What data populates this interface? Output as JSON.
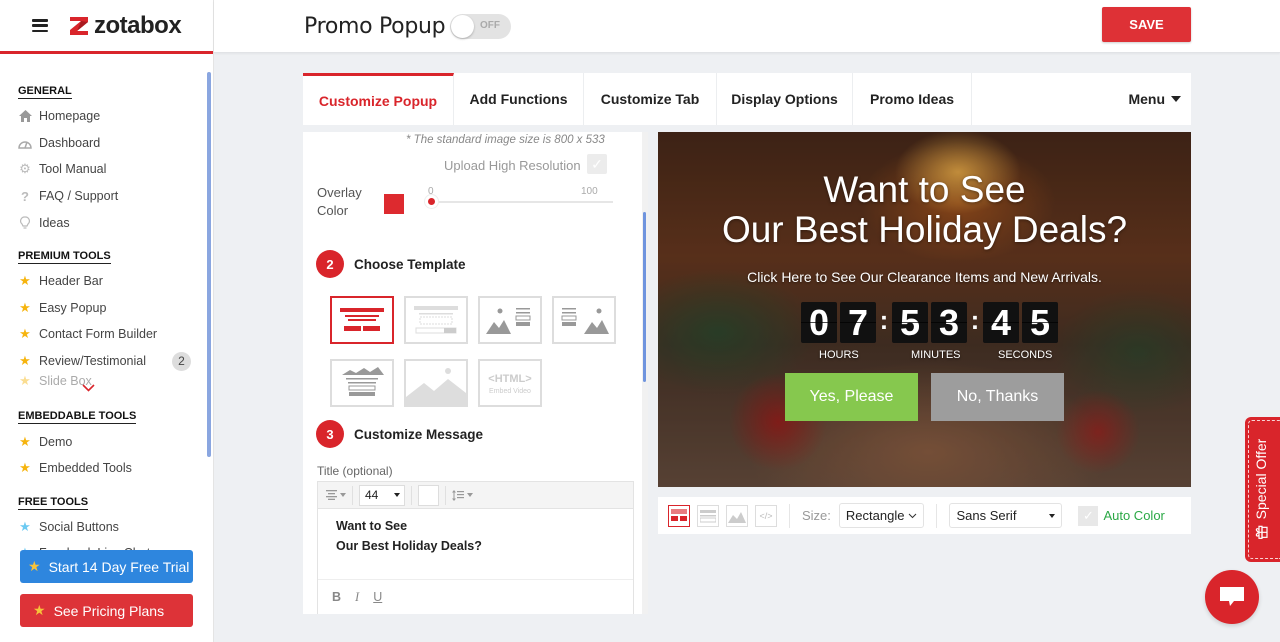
{
  "brand": {
    "name": "zotabox",
    "accent": "#d9252b"
  },
  "sidebar": {
    "sections": [
      {
        "title": "GENERAL",
        "items": [
          {
            "label": "Homepage",
            "icon": "home-icon"
          },
          {
            "label": "Dashboard",
            "icon": "dashboard-icon"
          },
          {
            "label": "Tool Manual",
            "icon": "gear-icon"
          },
          {
            "label": "FAQ / Support",
            "icon": "question-icon"
          },
          {
            "label": "Ideas",
            "icon": "lightbulb-icon"
          }
        ]
      },
      {
        "title": "PREMIUM TOOLS",
        "items": [
          {
            "label": "Header Bar",
            "icon": "star-icon"
          },
          {
            "label": "Easy Popup",
            "icon": "star-icon"
          },
          {
            "label": "Contact Form Builder",
            "icon": "star-icon"
          },
          {
            "label": "Review/Testimonial",
            "icon": "star-icon",
            "badge": "2"
          },
          {
            "label": "Slide Box",
            "icon": "star-icon"
          }
        ]
      },
      {
        "title": "EMBEDDABLE TOOLS",
        "items": [
          {
            "label": "Demo",
            "icon": "star-icon"
          },
          {
            "label": "Embedded Tools",
            "icon": "star-icon"
          }
        ]
      },
      {
        "title": "FREE TOOLS",
        "items": [
          {
            "label": "Social Buttons",
            "icon": "star-icon"
          },
          {
            "label": "Facebook Live Chat",
            "icon": "star-icon"
          }
        ]
      }
    ],
    "trial_button": "Start 14 Day Free Trial",
    "pricing_button": "See Pricing Plans"
  },
  "header": {
    "title": "Promo Popup",
    "toggle_state": "OFF",
    "save_label": "SAVE"
  },
  "tabs": [
    {
      "label": "Customize Popup",
      "active": true
    },
    {
      "label": "Add Functions"
    },
    {
      "label": "Customize Tab"
    },
    {
      "label": "Display Options"
    },
    {
      "label": "Promo Ideas"
    }
  ],
  "menu_label": "Menu",
  "panel": {
    "image_note": "* The standard image size is 800 x 533",
    "upload_hr_label": "Upload High Resolution",
    "overlay_label_1": "Overlay",
    "overlay_label_2": "Color",
    "overlay_color": "#dd2a2f",
    "slider_min": "0",
    "slider_max": "100",
    "slider_value": 0,
    "step2": {
      "num": "2",
      "title": "Choose Template"
    },
    "templates": [
      {
        "name": "text-buttons",
        "selected": true
      },
      {
        "name": "text-form"
      },
      {
        "name": "image-left"
      },
      {
        "name": "image-right"
      },
      {
        "name": "image-top"
      },
      {
        "name": "image-only"
      },
      {
        "name": "html-embed",
        "label1": "<HTML>",
        "label2": "Embed Video"
      }
    ],
    "step3": {
      "num": "3",
      "title": "Customize Message"
    },
    "title_field_label": "Title (optional)",
    "editor": {
      "font_size": "44",
      "line1": "Want to See",
      "line2": "Our Best Holiday Deals?",
      "bold": "B",
      "italic": "I",
      "underline": "U"
    }
  },
  "preview": {
    "title_line1": "Want to See",
    "title_line2": "Our Best Holiday Deals?",
    "subtitle": "Click Here to See Our Clearance Items and New Arrivals.",
    "countdown": {
      "hours": [
        "0",
        "7"
      ],
      "minutes": [
        "5",
        "3"
      ],
      "seconds": [
        "4",
        "5"
      ],
      "labels": {
        "hours": "HOURS",
        "minutes": "MINUTES",
        "seconds": "SECONDS"
      }
    },
    "yes_button": "Yes, Please",
    "no_button": "No, Thanks",
    "yes_color": "#86c84e",
    "no_color": "#9d9d9d"
  },
  "preview_toolbar": {
    "size_label": "Size:",
    "size_value": "Rectangle",
    "font_value": "Sans Serif",
    "auto_color_label": "Auto Color"
  },
  "special_offer": "Special Offer"
}
